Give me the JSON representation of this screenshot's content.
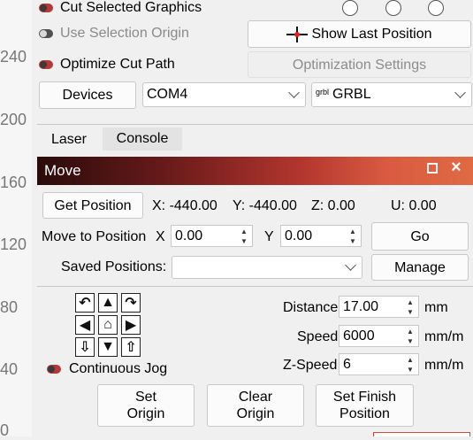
{
  "ruler": {
    "ticks": [
      "240",
      "200",
      "160",
      "120",
      "80",
      "40",
      "0"
    ]
  },
  "options": {
    "cut_selected": "Cut Selected Graphics",
    "use_selection_origin": "Use Selection Origin",
    "optimize_cut_path": "Optimize Cut Path",
    "show_last_position": "Show Last Position",
    "optimization_settings": "Optimization Settings"
  },
  "device": {
    "devices_label": "Devices",
    "port": "COM4",
    "controller_icon_text": "grbl",
    "controller": "GRBL"
  },
  "tabs": [
    {
      "label": "Laser"
    },
    {
      "label": "Console"
    }
  ],
  "move": {
    "title": "Move",
    "get_position": "Get Position",
    "x_readout": "X: -440.00",
    "y_readout": "Y: -440.00",
    "z_readout": "Z: 0.00",
    "u_readout": "U: 0.00",
    "move_to_label": "Move to Position",
    "x_label": "X",
    "x_value": "0.00",
    "y_label": "Y",
    "y_value": "0.00",
    "go": "Go",
    "saved_positions_label": "Saved Positions:",
    "manage": "Manage",
    "continuous_jog": "Continuous Jog",
    "distance_label": "Distance",
    "distance_value": "17.00",
    "distance_unit": "mm",
    "speed_label": "Speed",
    "speed_value": "6000",
    "speed_unit": "mm/m",
    "zspeed_label": "Z-Speed",
    "zspeed_value": "6",
    "zspeed_unit": "mm/m",
    "set_origin": "Set\nOrigin",
    "clear_origin": "Clear\nOrigin",
    "set_finish": "Set Finish\nPosition"
  },
  "colors": {
    "accent": "#d14b3c",
    "toggle_on": "#b43a3a"
  }
}
